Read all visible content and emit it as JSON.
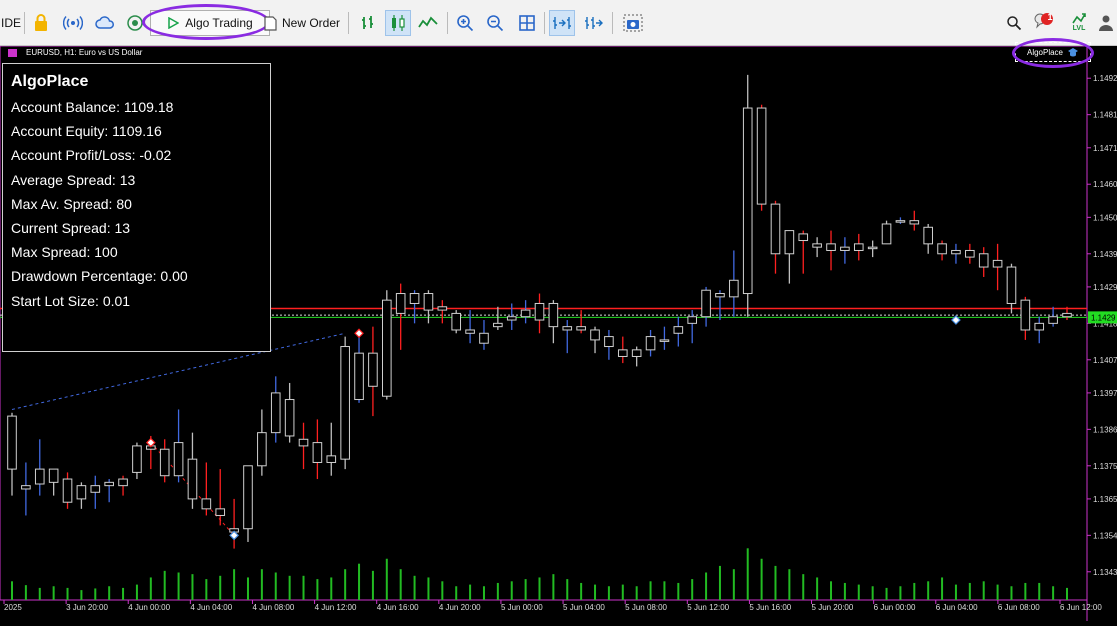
{
  "toolbar": {
    "ide_label": "IDE",
    "algo_trading_label": "Algo Trading",
    "new_order_label": "New Order",
    "notification_count": "1",
    "lvl_label": "LVL"
  },
  "chart": {
    "title": "EURUSD, H1:  Euro vs US Dollar",
    "expert_name": "AlgoPlace",
    "current_price": "1.1429"
  },
  "info_panel": {
    "title": "AlgoPlace",
    "rows": [
      "Account Balance: 1109.18",
      "Account Equity: 1109.16",
      "Account Profit/Loss: -0.02",
      "Average Spread: 13",
      "Max Av. Spread: 80",
      "Current Spread: 13",
      "Max Spread: 100",
      "Drawdown Percentage: 0.00",
      "Start Lot Size: 0.01"
    ]
  },
  "colors": {
    "bull": "#4169e1",
    "bear": "#ff2020",
    "neutral": "#bfbfbf",
    "volume": "#22bb22",
    "accent": "#cc33cc",
    "highlight": "#8a2be2",
    "price_tag": "#22dd22"
  },
  "chart_data": {
    "type": "candlestick",
    "symbol": "EURUSD",
    "timeframe": "H1",
    "y_ticks": [
      "1.1492",
      "1.1481",
      "1.1471",
      "1.1460",
      "1.1450",
      "1.1439",
      "1.1429",
      "1.1418",
      "1.1407",
      "1.1397",
      "1.1386",
      "1.1375",
      "1.1365",
      "1.1354",
      "1.1343"
    ],
    "y_range": [
      1.13375,
      1.14975
    ],
    "x_labels": [
      "2025",
      "3 Jun 20:00",
      "4 Jun 00:00",
      "4 Jun 04:00",
      "4 Jun 08:00",
      "4 Jun 12:00",
      "4 Jun 16:00",
      "4 Jun 20:00",
      "5 Jun 00:00",
      "5 Jun 04:00",
      "5 Jun 08:00",
      "5 Jun 12:00",
      "5 Jun 16:00",
      "5 Jun 20:00",
      "6 Jun 00:00",
      "6 Jun 04:00",
      "6 Jun 08:00",
      "6 Jun 12:00"
    ],
    "horizontal_lines": {
      "red": 1.14225,
      "green": 1.14198,
      "dotted": 1.14205
    },
    "candles": [
      {
        "o": 1.1374,
        "h": 1.1391,
        "l": 1.1366,
        "c": 1.139,
        "v": 0.34,
        "col": "neutral"
      },
      {
        "o": 1.1369,
        "h": 1.1376,
        "l": 1.136,
        "c": 1.1368,
        "v": 0.27,
        "col": "bull"
      },
      {
        "o": 1.13695,
        "h": 1.1383,
        "l": 1.1366,
        "c": 1.1374,
        "v": 0.22,
        "col": "bull"
      },
      {
        "o": 1.1374,
        "h": 1.1374,
        "l": 1.1366,
        "c": 1.137,
        "v": 0.25,
        "col": "neutral"
      },
      {
        "o": 1.1371,
        "h": 1.1373,
        "l": 1.1362,
        "c": 1.1364,
        "v": 0.22,
        "col": "bear"
      },
      {
        "o": 1.1365,
        "h": 1.137,
        "l": 1.1362,
        "c": 1.1369,
        "v": 0.18,
        "col": "neutral"
      },
      {
        "o": 1.1367,
        "h": 1.1372,
        "l": 1.1362,
        "c": 1.1369,
        "v": 0.21,
        "col": "bull"
      },
      {
        "o": 1.1369,
        "h": 1.1371,
        "l": 1.1364,
        "c": 1.137,
        "v": 0.25,
        "col": "bull"
      },
      {
        "o": 1.1371,
        "h": 1.1372,
        "l": 1.1366,
        "c": 1.1369,
        "v": 0.22,
        "col": "bear"
      },
      {
        "o": 1.1373,
        "h": 1.1382,
        "l": 1.1371,
        "c": 1.1381,
        "v": 0.28,
        "col": "neutral"
      },
      {
        "o": 1.1381,
        "h": 1.1384,
        "l": 1.1374,
        "c": 1.138,
        "v": 0.41,
        "col": "bear"
      },
      {
        "o": 1.138,
        "h": 1.1383,
        "l": 1.137,
        "c": 1.1372,
        "v": 0.53,
        "col": "bear"
      },
      {
        "o": 1.1372,
        "h": 1.1392,
        "l": 1.137,
        "c": 1.1382,
        "v": 0.5,
        "col": "bull"
      },
      {
        "o": 1.1377,
        "h": 1.1385,
        "l": 1.1362,
        "c": 1.1365,
        "v": 0.47,
        "col": "neutral"
      },
      {
        "o": 1.1365,
        "h": 1.1376,
        "l": 1.136,
        "c": 1.1362,
        "v": 0.38,
        "col": "bear"
      },
      {
        "o": 1.1362,
        "h": 1.1374,
        "l": 1.1357,
        "c": 1.136,
        "v": 0.44,
        "col": "bear"
      },
      {
        "o": 1.1355,
        "h": 1.1365,
        "l": 1.135,
        "c": 1.1356,
        "v": 0.56,
        "col": "bear"
      },
      {
        "o": 1.1356,
        "h": 1.1375,
        "l": 1.1352,
        "c": 1.1375,
        "v": 0.41,
        "col": "neutral"
      },
      {
        "o": 1.1375,
        "h": 1.1392,
        "l": 1.1372,
        "c": 1.1385,
        "v": 0.56,
        "col": "neutral"
      },
      {
        "o": 1.1385,
        "h": 1.1402,
        "l": 1.1382,
        "c": 1.1397,
        "v": 0.5,
        "col": "bull"
      },
      {
        "o": 1.1395,
        "h": 1.14,
        "l": 1.1382,
        "c": 1.1384,
        "v": 0.44,
        "col": "neutral"
      },
      {
        "o": 1.1383,
        "h": 1.1388,
        "l": 1.1374,
        "c": 1.1381,
        "v": 0.44,
        "col": "bear"
      },
      {
        "o": 1.1382,
        "h": 1.1389,
        "l": 1.1371,
        "c": 1.1376,
        "v": 0.38,
        "col": "bear"
      },
      {
        "o": 1.1378,
        "h": 1.1388,
        "l": 1.1372,
        "c": 1.1376,
        "v": 0.41,
        "col": "neutral"
      },
      {
        "o": 1.1377,
        "h": 1.1414,
        "l": 1.1374,
        "c": 1.1411,
        "v": 0.56,
        "col": "neutral"
      },
      {
        "o": 1.1409,
        "h": 1.1415,
        "l": 1.1394,
        "c": 1.1395,
        "v": 0.66,
        "col": "bull"
      },
      {
        "o": 1.1399,
        "h": 1.1417,
        "l": 1.139,
        "c": 1.1409,
        "v": 0.53,
        "col": "bear"
      },
      {
        "o": 1.1396,
        "h": 1.1428,
        "l": 1.1395,
        "c": 1.1425,
        "v": 0.75,
        "col": "neutral"
      },
      {
        "o": 1.1421,
        "h": 1.143,
        "l": 1.141,
        "c": 1.1427,
        "v": 0.56,
        "col": "bear"
      },
      {
        "o": 1.1424,
        "h": 1.1428,
        "l": 1.1418,
        "c": 1.1427,
        "v": 0.44,
        "col": "bull"
      },
      {
        "o": 1.1427,
        "h": 1.1428,
        "l": 1.1418,
        "c": 1.1422,
        "v": 0.41,
        "col": "neutral"
      },
      {
        "o": 1.1423,
        "h": 1.1425,
        "l": 1.1418,
        "c": 1.1422,
        "v": 0.34,
        "col": "bear"
      },
      {
        "o": 1.1421,
        "h": 1.1422,
        "l": 1.1415,
        "c": 1.1416,
        "v": 0.25,
        "col": "neutral"
      },
      {
        "o": 1.1415,
        "h": 1.1422,
        "l": 1.1412,
        "c": 1.1416,
        "v": 0.28,
        "col": "bull"
      },
      {
        "o": 1.1415,
        "h": 1.1419,
        "l": 1.141,
        "c": 1.1412,
        "v": 0.25,
        "col": "bull"
      },
      {
        "o": 1.1417,
        "h": 1.1423,
        "l": 1.1416,
        "c": 1.1418,
        "v": 0.31,
        "col": "neutral"
      },
      {
        "o": 1.1419,
        "h": 1.1424,
        "l": 1.1416,
        "c": 1.142,
        "v": 0.34,
        "col": "bull"
      },
      {
        "o": 1.142,
        "h": 1.1425,
        "l": 1.1418,
        "c": 1.1422,
        "v": 0.38,
        "col": "bull"
      },
      {
        "o": 1.1424,
        "h": 1.1427,
        "l": 1.1415,
        "c": 1.1419,
        "v": 0.41,
        "col": "bear"
      },
      {
        "o": 1.1424,
        "h": 1.1425,
        "l": 1.1412,
        "c": 1.1417,
        "v": 0.47,
        "col": "neutral"
      },
      {
        "o": 1.1417,
        "h": 1.1419,
        "l": 1.1409,
        "c": 1.1416,
        "v": 0.38,
        "col": "bull"
      },
      {
        "o": 1.1417,
        "h": 1.1422,
        "l": 1.1415,
        "c": 1.1416,
        "v": 0.31,
        "col": "bear"
      },
      {
        "o": 1.1416,
        "h": 1.1417,
        "l": 1.1409,
        "c": 1.1413,
        "v": 0.28,
        "col": "neutral"
      },
      {
        "o": 1.1414,
        "h": 1.1416,
        "l": 1.1407,
        "c": 1.1411,
        "v": 0.25,
        "col": "bull"
      },
      {
        "o": 1.141,
        "h": 1.1414,
        "l": 1.1406,
        "c": 1.1408,
        "v": 0.28,
        "col": "bear"
      },
      {
        "o": 1.1408,
        "h": 1.1411,
        "l": 1.1405,
        "c": 1.141,
        "v": 0.25,
        "col": "neutral"
      },
      {
        "o": 1.141,
        "h": 1.1416,
        "l": 1.1408,
        "c": 1.1414,
        "v": 0.34,
        "col": "bull"
      },
      {
        "o": 1.1413,
        "h": 1.1417,
        "l": 1.141,
        "c": 1.1413,
        "v": 0.34,
        "col": "bull"
      },
      {
        "o": 1.1415,
        "h": 1.142,
        "l": 1.1411,
        "c": 1.1417,
        "v": 0.31,
        "col": "bull"
      },
      {
        "o": 1.1418,
        "h": 1.1422,
        "l": 1.1412,
        "c": 1.142,
        "v": 0.38,
        "col": "bull"
      },
      {
        "o": 1.142,
        "h": 1.1429,
        "l": 1.1417,
        "c": 1.1428,
        "v": 0.5,
        "col": "bull"
      },
      {
        "o": 1.1427,
        "h": 1.1428,
        "l": 1.1419,
        "c": 1.1426,
        "v": 0.62,
        "col": "bull"
      },
      {
        "o": 1.1426,
        "h": 1.144,
        "l": 1.142,
        "c": 1.1431,
        "v": 0.56,
        "col": "bull"
      },
      {
        "o": 1.1427,
        "h": 1.1493,
        "l": 1.142,
        "c": 1.1483,
        "v": 0.94,
        "col": "neutral"
      },
      {
        "o": 1.1483,
        "h": 1.1484,
        "l": 1.1452,
        "c": 1.1454,
        "v": 0.75,
        "col": "bear"
      },
      {
        "o": 1.1454,
        "h": 1.1455,
        "l": 1.1433,
        "c": 1.1439,
        "v": 0.62,
        "col": "bear"
      },
      {
        "o": 1.1439,
        "h": 1.1446,
        "l": 1.143,
        "c": 1.1446,
        "v": 0.56,
        "col": "neutral"
      },
      {
        "o": 1.1445,
        "h": 1.1446,
        "l": 1.1433,
        "c": 1.1443,
        "v": 0.47,
        "col": "bear"
      },
      {
        "o": 1.1442,
        "h": 1.1444,
        "l": 1.1438,
        "c": 1.1441,
        "v": 0.41,
        "col": "neutral"
      },
      {
        "o": 1.1442,
        "h": 1.1446,
        "l": 1.1434,
        "c": 1.144,
        "v": 0.34,
        "col": "bear"
      },
      {
        "o": 1.1441,
        "h": 1.1444,
        "l": 1.1436,
        "c": 1.144,
        "v": 0.31,
        "col": "bull"
      },
      {
        "o": 1.1442,
        "h": 1.1445,
        "l": 1.1437,
        "c": 1.144,
        "v": 0.28,
        "col": "bear"
      },
      {
        "o": 1.1441,
        "h": 1.1443,
        "l": 1.1438,
        "c": 1.1441,
        "v": 0.25,
        "col": "neutral"
      },
      {
        "o": 1.1442,
        "h": 1.1449,
        "l": 1.1442,
        "c": 1.1448,
        "v": 0.22,
        "col": "neutral"
      },
      {
        "o": 1.1449,
        "h": 1.145,
        "l": 1.1448,
        "c": 1.1449,
        "v": 0.25,
        "col": "bull"
      },
      {
        "o": 1.1449,
        "h": 1.1452,
        "l": 1.1446,
        "c": 1.1448,
        "v": 0.31,
        "col": "bear"
      },
      {
        "o": 1.1447,
        "h": 1.1448,
        "l": 1.1439,
        "c": 1.1442,
        "v": 0.34,
        "col": "neutral"
      },
      {
        "o": 1.1442,
        "h": 1.1443,
        "l": 1.1437,
        "c": 1.1439,
        "v": 0.41,
        "col": "bear"
      },
      {
        "o": 1.1439,
        "h": 1.1442,
        "l": 1.1436,
        "c": 1.144,
        "v": 0.28,
        "col": "bull"
      },
      {
        "o": 1.144,
        "h": 1.1442,
        "l": 1.1436,
        "c": 1.1438,
        "v": 0.31,
        "col": "bear"
      },
      {
        "o": 1.1439,
        "h": 1.1441,
        "l": 1.1432,
        "c": 1.1435,
        "v": 0.34,
        "col": "bear"
      },
      {
        "o": 1.1437,
        "h": 1.1442,
        "l": 1.1428,
        "c": 1.1435,
        "v": 0.28,
        "col": "bear"
      },
      {
        "o": 1.1435,
        "h": 1.1436,
        "l": 1.1421,
        "c": 1.1424,
        "v": 0.25,
        "col": "neutral"
      },
      {
        "o": 1.1425,
        "h": 1.1426,
        "l": 1.1413,
        "c": 1.1416,
        "v": 0.31,
        "col": "bear"
      },
      {
        "o": 1.1416,
        "h": 1.142,
        "l": 1.1412,
        "c": 1.1418,
        "v": 0.31,
        "col": "bull"
      },
      {
        "o": 1.1418,
        "h": 1.1423,
        "l": 1.1417,
        "c": 1.142,
        "v": 0.25,
        "col": "bull"
      },
      {
        "o": 1.142,
        "h": 1.1423,
        "l": 1.1419,
        "c": 1.1421,
        "v": 0.22,
        "col": "bear"
      }
    ]
  }
}
